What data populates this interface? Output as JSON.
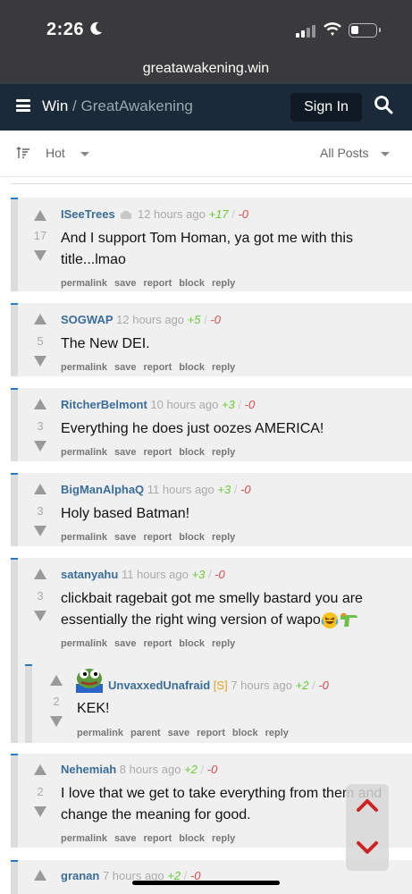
{
  "status_bar": {
    "time": "2:26"
  },
  "url_bar": {
    "domain": "greatawakening.win"
  },
  "header": {
    "site": "Win",
    "separator": "/",
    "community": "GreatAwakening",
    "signin_label": "Sign In"
  },
  "sort_bar": {
    "sort_value": "Hot",
    "filter_value": "All Posts"
  },
  "comments": [
    {
      "author": "ISeeTrees",
      "time": "12 hours ago",
      "plus": "+17",
      "minus": "-0",
      "score": "17",
      "body": "And I support Tom Homan, ya got me with this title...lmao"
    },
    {
      "author": "SOGWAP",
      "time": "12 hours ago",
      "plus": "+5",
      "minus": "-0",
      "score": "5",
      "body": "The New DEI."
    },
    {
      "author": "RitcherBelmont",
      "time": "10 hours ago",
      "plus": "+3",
      "minus": "-0",
      "score": "3",
      "body": "Everything he does just oozes AMERICA!"
    },
    {
      "author": "BigManAlphaQ",
      "time": "11 hours ago",
      "plus": "+3",
      "minus": "-0",
      "score": "3",
      "body": "Holy based Batman!"
    },
    {
      "author": "satanyahu",
      "time": "11 hours ago",
      "plus": "+3",
      "minus": "-0",
      "score": "3",
      "body_line1": "clickbait ragebait got me smelly bastard you are",
      "body_line2": "essentially the right wing version of wapo"
    },
    {
      "author": "UnvaxxedUnafraid",
      "tag": "[S]",
      "time": "7 hours ago",
      "plus": "+2",
      "minus": "-0",
      "score": "2",
      "body": "KEK!"
    },
    {
      "author": "Nehemiah",
      "time": "8 hours ago",
      "plus": "+2",
      "minus": "-0",
      "score": "2",
      "body_line1": "I love that we get to take everything from them and",
      "body_line2": "change the meaning for good."
    },
    {
      "author": "granan",
      "time": "7 hours ago",
      "plus": "+2",
      "minus": "-0"
    }
  ],
  "actions": {
    "permalink": "permalink",
    "save": "save",
    "report": "report",
    "block": "block",
    "reply": "reply",
    "parent": "parent"
  },
  "colors": {
    "header_bg": "#1a2a38",
    "author": "#3a6d9a",
    "upvote": "#66cc33",
    "downvote": "#d94b4b",
    "thread_bar": "#2a7ac0"
  }
}
